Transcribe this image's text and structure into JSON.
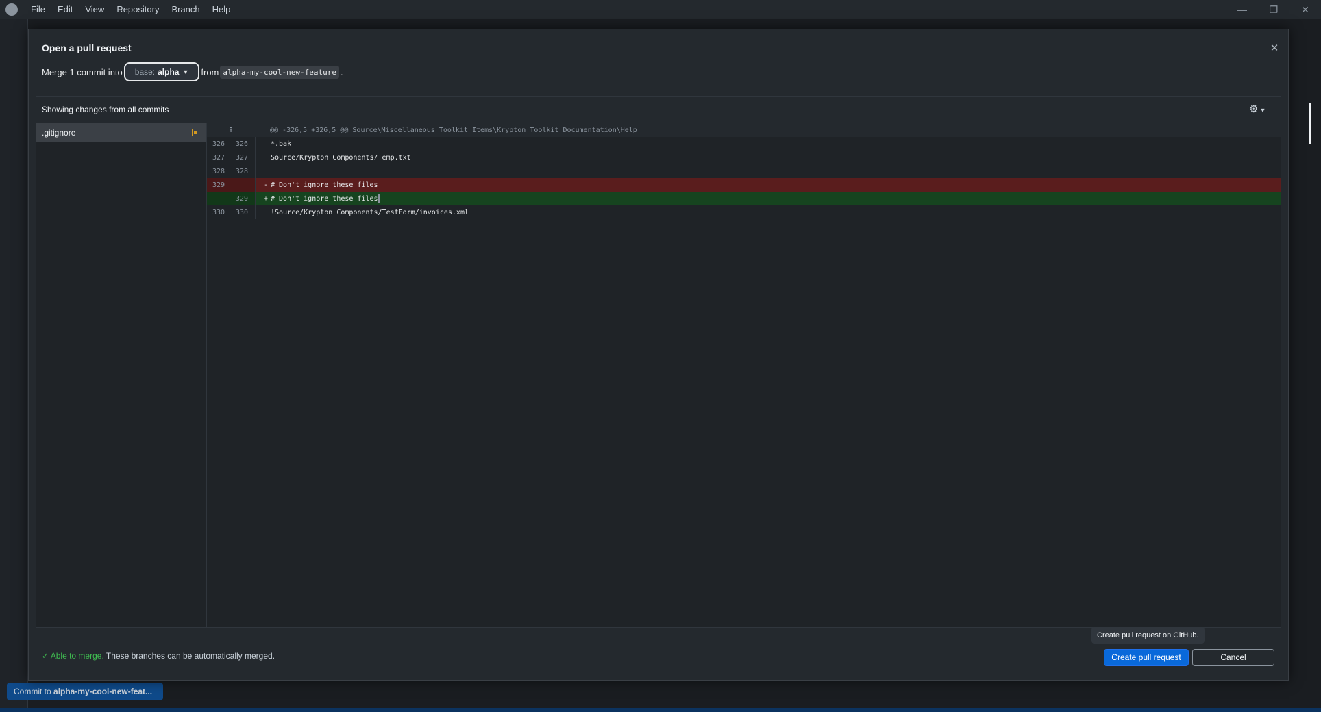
{
  "menu": {
    "items": [
      "File",
      "Edit",
      "View",
      "Repository",
      "Branch",
      "Help"
    ]
  },
  "window_controls": {
    "minimize": "—",
    "restore": "❐",
    "close": "✕"
  },
  "background": {
    "commit_button_prefix": "Commit to ",
    "commit_button_branch": "alpha-my-cool-new-feat..."
  },
  "dialog": {
    "title": "Open a pull request",
    "close_icon": "✕",
    "merge_prefix": "Merge 1 commit into",
    "base_label": "base:",
    "base_value": "alpha",
    "from_label": "from",
    "compare_branch": "alpha-my-cool-new-feature",
    "period": ".",
    "changes_title": "Showing changes from all commits",
    "gear_icon": "⚙"
  },
  "files": [
    {
      "name": ".gitignore",
      "status": "modified"
    }
  ],
  "diff": {
    "hunk_header": "@@ -326,5 +326,5 @@ Source\\Miscellaneous Toolkit Items\\Krypton Toolkit Documentation\\Help",
    "expand_icon": "⭱",
    "lines": [
      {
        "old": "326",
        "new": "326",
        "marker": "",
        "text": "*.bak",
        "type": "context"
      },
      {
        "old": "327",
        "new": "327",
        "marker": "",
        "text": "Source/Krypton Components/Temp.txt",
        "type": "context"
      },
      {
        "old": "328",
        "new": "328",
        "marker": "",
        "text": "",
        "type": "context"
      },
      {
        "old": "329",
        "new": "",
        "marker": "-",
        "text": "# Don't ignore these files",
        "type": "deleted"
      },
      {
        "old": "",
        "new": "329",
        "marker": "+",
        "text": "# Don't ignore these files",
        "type": "added"
      },
      {
        "old": "330",
        "new": "330",
        "marker": "",
        "text": "!Source/Krypton Components/TestForm/invoices.xml",
        "type": "context"
      }
    ]
  },
  "footer": {
    "merge_ok": "Able to merge.",
    "merge_detail": " These branches can be automatically merged.",
    "check_icon": "✓",
    "tooltip": "Create pull request on GitHub.",
    "create_label": "Create pull request",
    "cancel_label": "Cancel"
  }
}
